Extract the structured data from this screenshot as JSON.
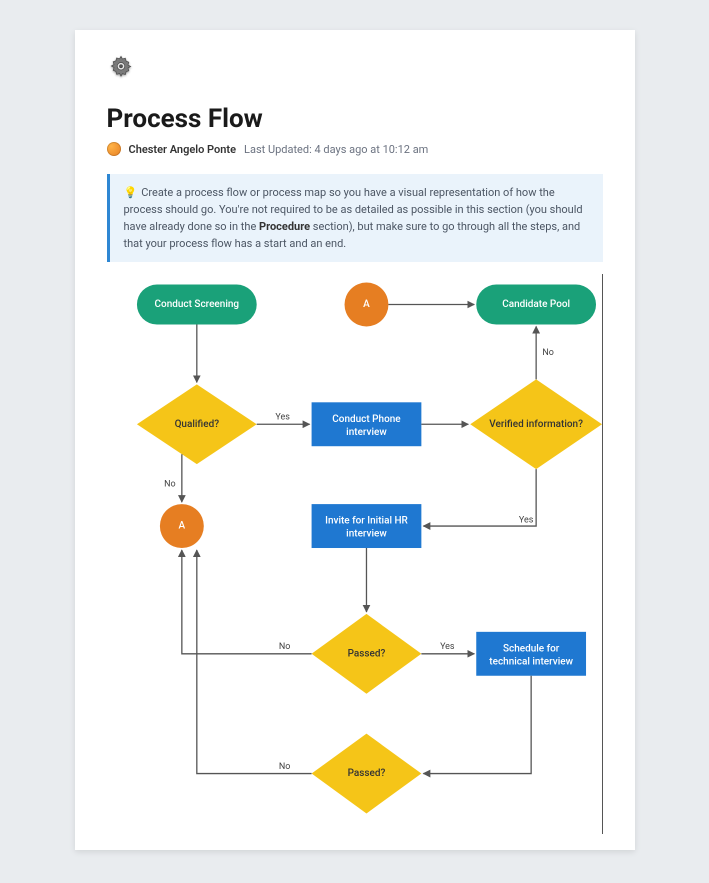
{
  "title": "Process Flow",
  "author": "Chester Angelo Ponte",
  "last_updated_prefix": "Last Updated: ",
  "last_updated": "4 days ago at 10:12 am",
  "callout_emoji": "💡",
  "callout_before": "Create a process flow or process map so you have a visual representation of how the process should go. You're not required to be as detailed as possible in this section (you should have already done so in the ",
  "callout_bold": "Procedure",
  "callout_after": " section), but make sure to go through all the steps, and that your process flow has a start and an end.",
  "nodes": {
    "conduct_screening": "Conduct Screening",
    "connector_a_top": "A",
    "candidate_pool": "Candidate Pool",
    "qualified": "Qualified?",
    "conduct_phone_1": "Conduct Phone",
    "conduct_phone_2": "interview",
    "verified_info": "Verified information?",
    "connector_a_left": "A",
    "invite_hr_1": "Invite for Initial HR",
    "invite_hr_2": "interview",
    "passed1": "Passed?",
    "schedule_tech_1": "Schedule for",
    "schedule_tech_2": "technical interview",
    "passed2": "Passed?"
  },
  "edges": {
    "qualified_yes": "Yes",
    "qualified_no": "No",
    "verified_no": "No",
    "verified_yes": "Yes",
    "passed1_no": "No",
    "passed1_yes": "Yes",
    "passed2_no": "No"
  },
  "colors": {
    "terminal": "#1aa179",
    "connector": "#e67e22",
    "process": "#1f78d1",
    "decision": "#f5c518",
    "arrow": "#555"
  }
}
